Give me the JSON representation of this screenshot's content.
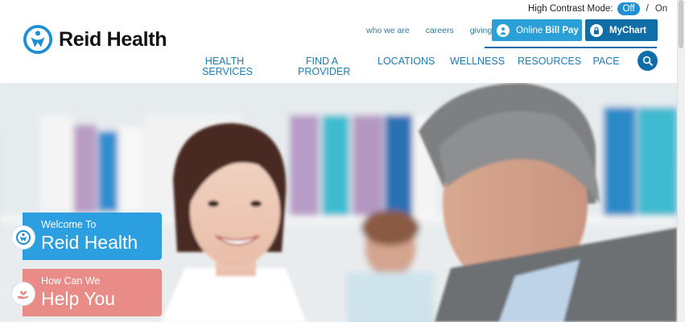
{
  "contrast": {
    "label": "High Contrast Mode:",
    "off": "Off",
    "separator": "/",
    "on": "On",
    "state": "off"
  },
  "brand": {
    "name": "Reid Health",
    "color": "#1d8fd4"
  },
  "utility_links": [
    "who we are",
    "careers",
    "giving"
  ],
  "buttons": {
    "bill_pay": {
      "prefix": "Online ",
      "strong": "Bill Pay",
      "icon": "person-icon",
      "color": "#2a9fd8"
    },
    "mychart": {
      "label": "MyChart",
      "icon": "lock-icon",
      "color": "#0f6ea8"
    }
  },
  "nav": [
    {
      "line1": "HEALTH",
      "line2": "SERVICES"
    },
    {
      "line1": "FIND A",
      "line2": "PROVIDER"
    },
    {
      "line1": "LOCATIONS",
      "line2": ""
    },
    {
      "line1": "WELLNESS",
      "line2": ""
    },
    {
      "line1": "RESOURCES",
      "line2": ""
    },
    {
      "line1": "PACE",
      "line2": ""
    }
  ],
  "search": {
    "icon": "search-icon"
  },
  "hero": {
    "welcome": {
      "small": "Welcome To",
      "big": "Reid Health",
      "color": "#2b9fe0",
      "icon": "reid-logo-icon"
    },
    "help": {
      "small": "How Can We",
      "big": "Help You",
      "color": "#e98b86",
      "icon": "heart-hand-icon"
    }
  }
}
